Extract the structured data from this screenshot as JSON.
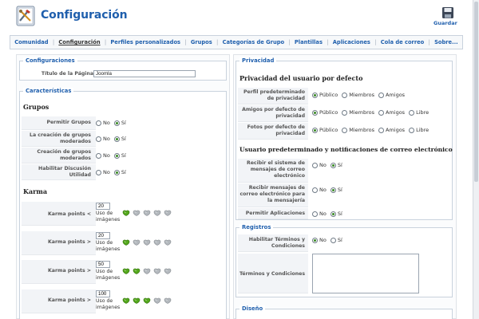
{
  "header": {
    "title": "Configuración",
    "save_label": "Guardar"
  },
  "tabs": [
    {
      "label": "Comunidad"
    },
    {
      "label": "Configuración"
    },
    {
      "label": "Perfiles personalizados"
    },
    {
      "label": "Grupos"
    },
    {
      "label": "Categorías de Grupo"
    },
    {
      "label": "Plantillas"
    },
    {
      "label": "Aplicaciones"
    },
    {
      "label": "Cola de correo"
    },
    {
      "label": "Sobre..."
    }
  ],
  "config": {
    "legend": "Configuraciones",
    "title_label": "Título de la Página",
    "title_value": "Joomla"
  },
  "features": {
    "legend": "Características",
    "groups_heading": "Grupos",
    "rows": [
      {
        "label": "Permitir Grupos",
        "no": "No",
        "yes": "Sí"
      },
      {
        "label": "La creación de grupos moderados",
        "no": "No",
        "yes": "Sí"
      },
      {
        "label": "Creación de grupos moderados",
        "no": "No",
        "yes": "Sí"
      },
      {
        "label": "Habilitar Discusión Utilidad",
        "no": "No",
        "yes": "Sí"
      }
    ],
    "karma_heading": "Karma",
    "karma": [
      {
        "label": "Karma points <",
        "value": "20",
        "use": "Uso de imágenes",
        "active": 1
      },
      {
        "label": "Karma points >",
        "value": "20",
        "use": "Uso de imágenes",
        "active": 1
      },
      {
        "label": "Karma points >",
        "value": "50",
        "use": "Uso de imágenes",
        "active": 2
      },
      {
        "label": "Karma points >",
        "value": "100",
        "use": "Uso de imágenes",
        "active": 3
      }
    ]
  },
  "privacy": {
    "legend": "Privacidad",
    "heading1": "Privacidad del usuario por defecto",
    "rows": [
      {
        "label": "Perfil predeterminado de privacidad",
        "options": [
          "Público",
          "Miembros",
          "Amigos"
        ],
        "selected": 0
      },
      {
        "label": "Amigos por defecto de privacidad",
        "options": [
          "Público",
          "Miembros",
          "Amigos",
          "Libre"
        ],
        "selected": 0
      },
      {
        "label": "Fotos por defecto de privacidad",
        "options": [
          "Público",
          "Miembros",
          "Amigos",
          "Libre"
        ],
        "selected": 0
      }
    ],
    "heading2": "Usuario predeterminado y notificaciones de correo electrónico",
    "rows2": [
      {
        "label": "Recibir el sistema de mensajes de correo electrónico",
        "no": "No",
        "yes": "Sí"
      },
      {
        "label": "Recibir mensajes de correo electrónico para la mensajería",
        "no": "No",
        "yes": "Sí"
      },
      {
        "label": "Permitir Aplicaciones",
        "no": "No",
        "yes": "Sí"
      }
    ]
  },
  "registros": {
    "legend": "Registros",
    "terms_enable_label": "Habilitar Términos y Condiciones",
    "no": "No",
    "yes": "Sí",
    "terms_label": "Términos y Condiciones"
  },
  "diseno": {
    "legend": "Diseño"
  }
}
